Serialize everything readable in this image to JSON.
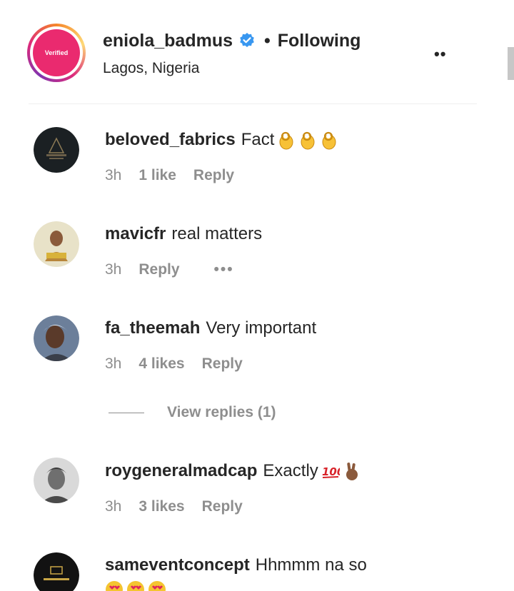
{
  "post": {
    "owner": "eniola_badmus",
    "separator": "•",
    "follow_status": "Following",
    "location": "Lagos, Nigeria",
    "avatar_text": "Verified",
    "more": "••"
  },
  "comments": [
    {
      "username": "beloved_fabrics",
      "text": "Fact",
      "emoji": [
        "ok-hand",
        "ok-hand",
        "ok-hand"
      ],
      "time": "3h",
      "likes": "1 like",
      "reply": "Reply"
    },
    {
      "username": "mavicfr",
      "text": "real matters",
      "time": "3h",
      "reply": "Reply",
      "more": "•••"
    },
    {
      "username": "fa_theemah",
      "text": "Very important",
      "time": "3h",
      "likes": "4 likes",
      "reply": "Reply",
      "view_replies": "View replies (1)"
    },
    {
      "username": "roygeneralmadcap",
      "text": "Exactly",
      "emoji": [
        "hundred-points",
        "victory-hand"
      ],
      "time": "3h",
      "likes": "3 likes",
      "reply": "Reply"
    },
    {
      "username": "sameventconcept",
      "text": "Hhmmm na so",
      "emoji": [
        "heart-eyes",
        "heart-eyes",
        "heart-eyes"
      ]
    }
  ],
  "colors": {
    "verified": "#3897f0",
    "avatar_pink": "#ea2a6f",
    "meta_gray": "#8e8e8e"
  }
}
